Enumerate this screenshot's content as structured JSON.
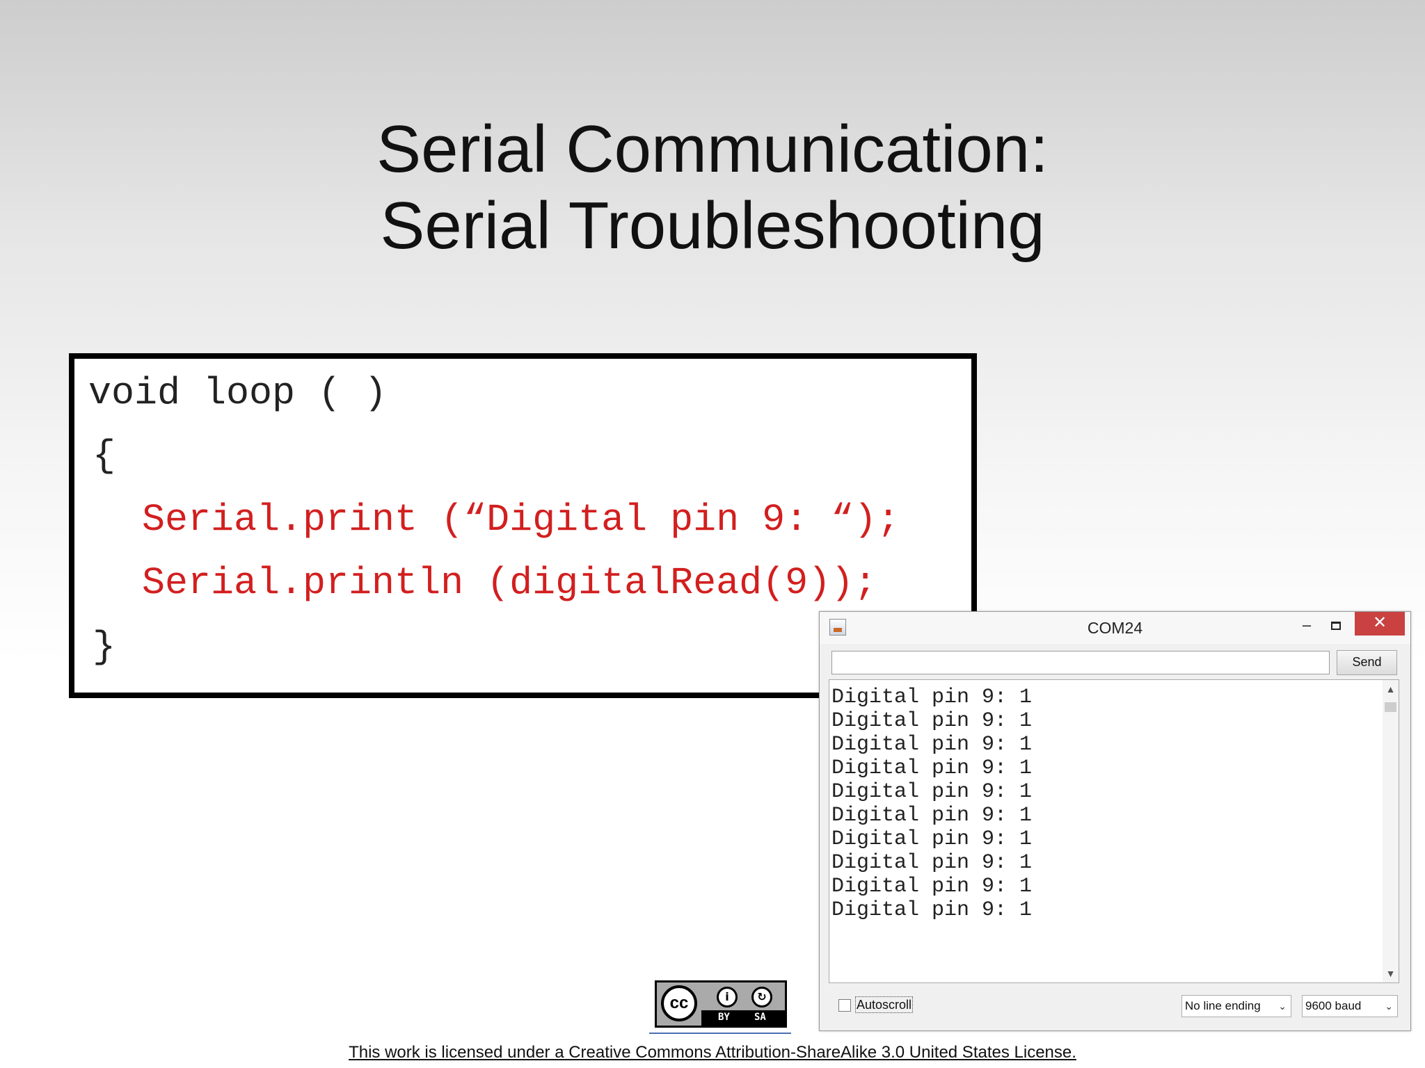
{
  "slide": {
    "title_line1": "Serial Communication:",
    "title_line2": "Serial Troubleshooting"
  },
  "code": {
    "line1": "void loop ( )",
    "line2": "{",
    "line3": "Serial.print (“Digital pin 9: “);",
    "line4": "Serial.println (digitalRead(9));",
    "line5": "}",
    "highlight_color": "#d21f1f"
  },
  "monitor": {
    "title": "COM24",
    "minimize_glyph": "–",
    "close_glyph": "✕",
    "send_label": "Send",
    "input_value": "",
    "output_lines": [
      "Digital pin 9: 1",
      "Digital pin 9: 1",
      "Digital pin 9: 1",
      "Digital pin 9: 1",
      "Digital pin 9: 1",
      "Digital pin 9: 1",
      "Digital pin 9: 1",
      "Digital pin 9: 1",
      "Digital pin 9: 1",
      "Digital pin 9: 1"
    ],
    "autoscroll_label": "Autoscroll",
    "autoscroll_checked": false,
    "line_ending": "No line ending",
    "baud": "9600 baud",
    "close_color": "#c94141"
  },
  "license": {
    "badge_cc": "cc",
    "badge_by": "BY",
    "badge_sa": "SA",
    "text": "This work is licensed under a Creative Commons Attribution-ShareAlike 3.0 United States License."
  },
  "icons": [
    "app-icon",
    "minimize-icon",
    "maximize-icon",
    "close-icon",
    "scroll-up-icon",
    "scroll-down-icon",
    "chevron-down-icon",
    "cc-icon",
    "attribution-icon",
    "share-alike-icon"
  ]
}
